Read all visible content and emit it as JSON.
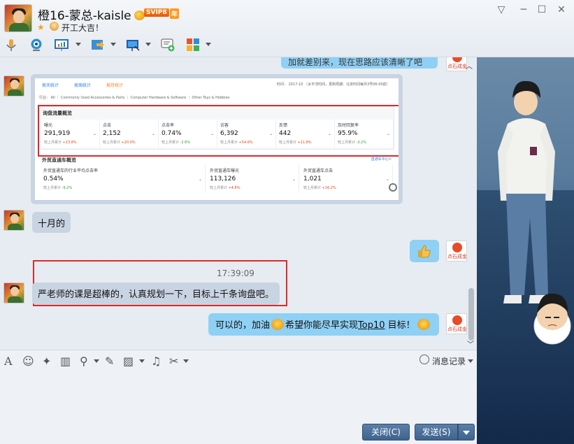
{
  "header": {
    "contact_name": "橙16-蒙总-kaisle",
    "svip_badge": "SVIP8",
    "year_badge": "年",
    "signature": "开工大吉！",
    "window_buttons": [
      "▽",
      "─",
      "☐",
      "✕"
    ]
  },
  "embedded": {
    "tabs": [
      "按天统计",
      "按周统计",
      "按月统计"
    ],
    "filter": "行业：  All  ｜  Commonly Used Accessories & Parts  ｜  Computer Hardware & Software  ｜  Other Toys & Hobbies",
    "time_note": "时间：  2017-10 （太平洋时间，更新周期：北京时间每月3号06:00前）",
    "section1_title": "询盘流量概览",
    "metrics": [
      {
        "label": "曝光",
        "value": "291,919",
        "change": "较上月累计 +23.8%"
      },
      {
        "label": "点击",
        "value": "2,152",
        "change": "较上月累计 +20.0%"
      },
      {
        "label": "点击率",
        "value": "0.74%",
        "change": "较上月累计 -2.6%"
      },
      {
        "label": "访客",
        "value": "6,392",
        "change": "较上月累计 +54.6%"
      },
      {
        "label": "反馈",
        "value": "442",
        "change": "较上月累计 +11.8%"
      },
      {
        "label": "及时回复率",
        "value": "95.9%",
        "change": "较上月累计 -3.2%"
      }
    ],
    "section2_title": "外贸直通车概览",
    "section2_link": "直通车中心>",
    "metrics2": [
      {
        "label": "外贸直通车的行业平均点击率",
        "value": "0.54%",
        "change": "较上月累计 -9.2%"
      },
      {
        "label": "外贸直通车曝光",
        "value": "113,126",
        "change": "较上月累计 +4.8%"
      },
      {
        "label": "外贸直通车点击",
        "value": "1,021",
        "change": "较上月累计 +16.2%"
      }
    ]
  },
  "messages": {
    "top_partial": "加就差别来，现在思路应该清晰了吧",
    "m1": "十月的",
    "time": "17:39:09",
    "m2": "严老师的课是超棒的，认真规划一下，目标上千条询盘吧。",
    "m3_pre": "可以的，加油",
    "m3_post": "希望你能尽早实现",
    "m3_link": "Top10",
    "m3_end": " 目标！",
    "logo_text": "点石成金"
  },
  "input_toolbar": {
    "history_label": "消息记录"
  },
  "buttons": {
    "close": "关闭(C)",
    "send": "发送(S)"
  },
  "colors": {
    "accent": "#3f638d",
    "bubble_right": "#8fd0f5",
    "bubble_left": "#c9d4e2",
    "highlight_box": "#e02828"
  }
}
